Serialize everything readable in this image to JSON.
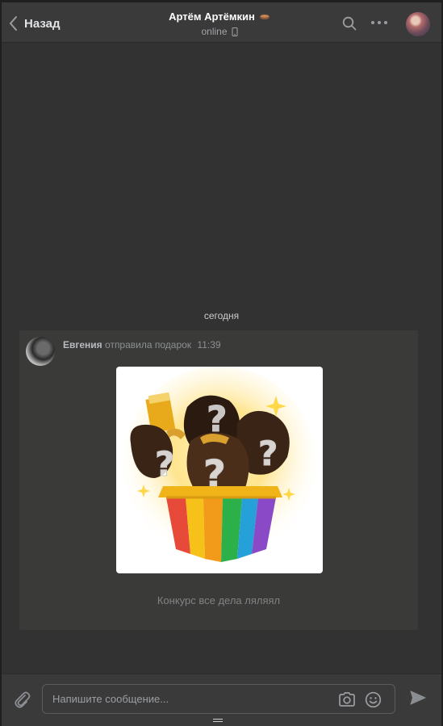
{
  "header": {
    "back_label": "Назад",
    "contact_name": "Артём Артёмкин",
    "status": "online",
    "icons": {
      "back": "chevron-left-icon",
      "search": "search-icon",
      "more": "more-dots-icon",
      "device": "mobile-phone-icon",
      "emoji": "emoji-icon"
    }
  },
  "date_separator": "сегодня",
  "message": {
    "author": "Евгения",
    "action": "отправила подарок",
    "time": "11:39",
    "gift_caption": "Конкурс все дела ляляял"
  },
  "composer": {
    "placeholder": "Напишите сообщение...",
    "icons": [
      "paperclip-icon",
      "camera-icon",
      "smile-icon",
      "send-icon"
    ]
  },
  "colors": {
    "background": "#323232",
    "header": "#3a3a3a",
    "message_card": "#3a3a38",
    "text_primary": "#e1e3e6",
    "text_secondary": "#8c8f94"
  }
}
